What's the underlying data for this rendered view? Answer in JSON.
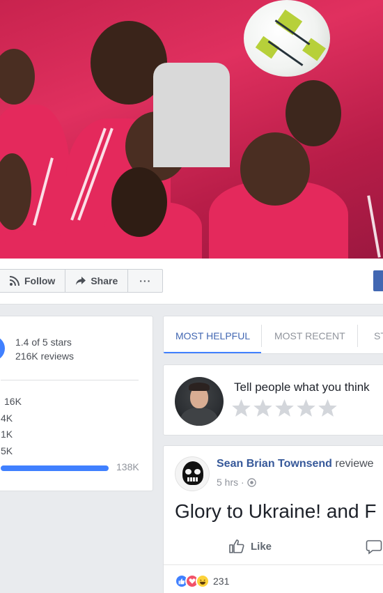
{
  "actions": {
    "follow_label": "Follow",
    "share_label": "Share",
    "more_label": "···"
  },
  "rating": {
    "summary": "1.4 of 5 stars",
    "review_count": "216K reviews",
    "star_value": 1.4,
    "breakdown": [
      "16K",
      "4K",
      "1K",
      "5K"
    ],
    "one_star_count": "138K"
  },
  "tabs": [
    {
      "label": "MOST HELPFUL",
      "active": true
    },
    {
      "label": "MOST RECENT",
      "active": false
    },
    {
      "label": "ST",
      "active": false
    }
  ],
  "compose": {
    "prompt": "Tell people what you think"
  },
  "review": {
    "reviewer_name": "Sean Brian Townsend",
    "verb": "reviewe",
    "time": "5 hrs ·",
    "text": "Glory to Ukraine! and F",
    "like_label": "Like",
    "reaction_count": "231"
  },
  "colors": {
    "brand_blue": "#4267b2",
    "accent_blue": "#4080ff",
    "link_blue": "#365899",
    "cover_red": "#e4295c"
  }
}
